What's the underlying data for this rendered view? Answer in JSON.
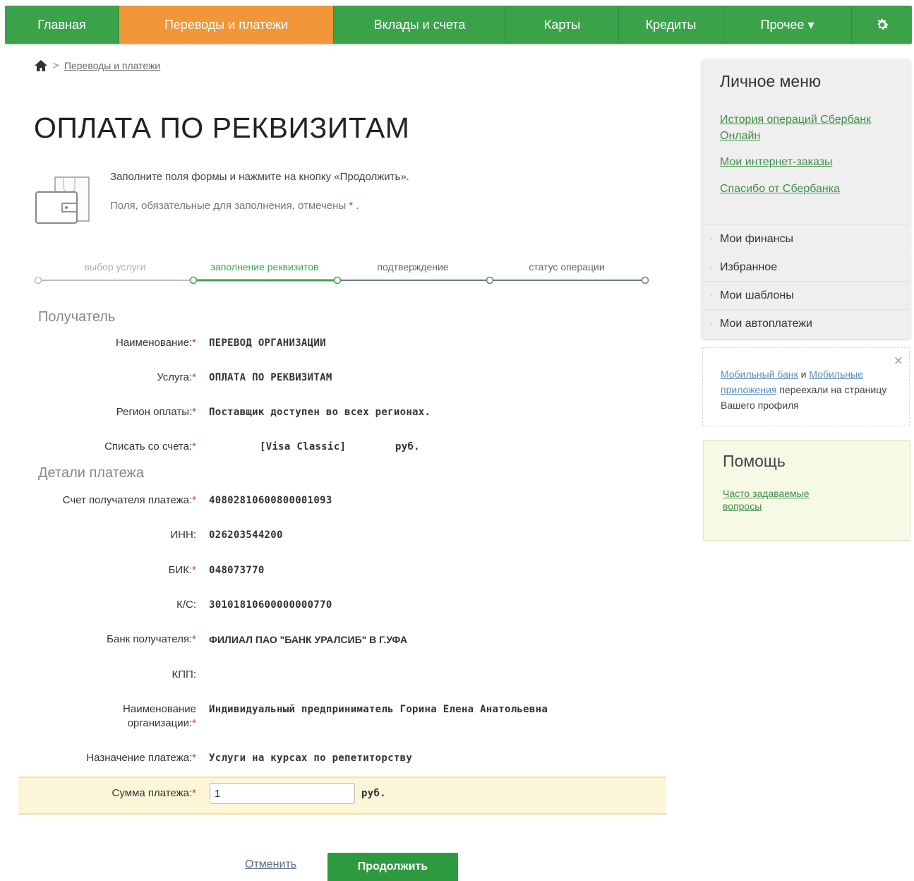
{
  "nav": {
    "items": [
      "Главная",
      "Переводы и платежи",
      "Вклады и счета",
      "Карты",
      "Кредиты",
      "Прочее ▾"
    ],
    "active_index": 1,
    "settings_icon": "gear-icon"
  },
  "breadcrumb": {
    "home_icon": "home-icon",
    "separator": ">",
    "link": "Переводы и платежи"
  },
  "page": {
    "title": "ОПЛАТА ПО РЕКВИЗИТАМ",
    "instruction": "Заполните поля формы и нажмите на кнопку «Продолжить».",
    "required_note": "Поля, обязательные для заполнения, отмечены",
    "required_mark": "*",
    "required_note_end": "."
  },
  "steps": [
    "выбор услуги",
    "заполнение реквизитов",
    "подтверждение",
    "статус операции"
  ],
  "recipient": {
    "section_title": "Получатель",
    "name_label": "Наименование:",
    "name_value": "ПЕРЕВОД ОРГАНИЗАЦИИ",
    "service_label": "Услуга:",
    "service_value": "ОПЛАТА ПО РЕКВИЗИТАМ",
    "region_label": "Регион оплаты:",
    "region_value": "Поставщик доступен во всех регионах.",
    "account_label": "Списать со счета:",
    "account_value": "[Visa Classic]",
    "account_currency": "руб."
  },
  "details": {
    "section_title": "Детали платежа",
    "acct_label": "Счет получателя платежа:",
    "acct_value": "40802810600800001093",
    "inn_label": "ИНН:",
    "inn_value": "026203544200",
    "bik_label": "БИК:",
    "bik_value": "048073770",
    "ks_label": "К/С:",
    "ks_value": "30101810600000000770",
    "bank_label": "Банк получателя:",
    "bank_value": "ФИЛИАЛ ПАО \"БАНК УРАЛСИБ\" В Г.УФА",
    "kpp_label": "КПП:",
    "org_label_1": "Наименование",
    "org_label_2": "организации:",
    "org_value": "Индивидуальный предприниматель Горина Елена Анатольевна",
    "purpose_label": "Назначение платежа:",
    "purpose_value": "Услуги на курсах по репетиторству",
    "amount_label": "Сумма платежа:",
    "amount_value": "1",
    "amount_currency": "руб."
  },
  "actions": {
    "cancel": "Отменить",
    "continue": "Продолжить"
  },
  "sidebar": {
    "title": "Личное меню",
    "links": [
      "История операций Сбербанк Онлайн",
      "Мои интернет-заказы",
      "Спасибо от Сбербанка"
    ],
    "items": [
      "Мои финансы",
      "Избранное",
      "Мои шаблоны",
      "Мои автоплатежи"
    ]
  },
  "notice": {
    "link1": "Мобильный банк",
    "and": " и ",
    "link2": "Мобильные приложения",
    "rest": " переехали на страницу Вашего профиля",
    "close": "×"
  },
  "help": {
    "title": "Помощь",
    "faq": "Часто задаваемые вопросы"
  },
  "colors": {
    "brand_green": "#3aa34a",
    "active_orange": "#f2963a",
    "required_red": "#e03030"
  }
}
